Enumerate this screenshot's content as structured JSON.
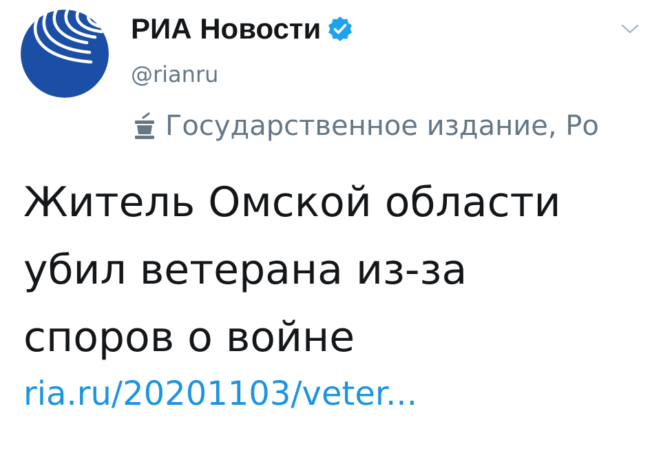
{
  "account": {
    "display_name": "РИА Новости",
    "handle": "@rianru",
    "verified": true,
    "label": "Государственное издание, Ро",
    "avatar_icon": "ria-novosti-logo-icon",
    "label_icon": "government-podium-icon"
  },
  "tweet": {
    "text_lines": [
      "Житель Омской области",
      "убил ветерана из-за",
      "споров о войне"
    ],
    "link": "ria.ru/20201103/veter..."
  },
  "colors": {
    "brand_blue": "#1b4fa6",
    "link_blue": "#1b95e0",
    "verified_blue": "#1da1f2",
    "secondary_text": "#657786",
    "primary_text": "#14171a"
  }
}
